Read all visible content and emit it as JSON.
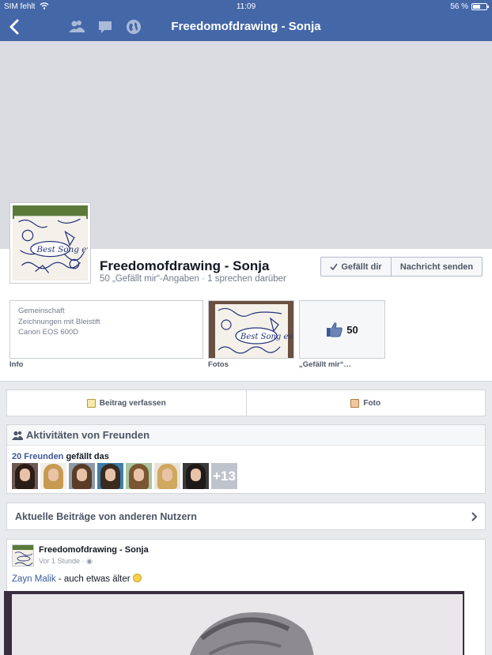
{
  "status_bar": {
    "carrier": "SIM fehlt",
    "time": "11:09",
    "battery": "56 %"
  },
  "nav": {
    "title": "Freedomofdrawing - Sonja",
    "icons": [
      "back-chevron-icon",
      "friends-icon",
      "messages-icon",
      "globe-icon"
    ]
  },
  "page": {
    "name": "Freedomofdrawing - Sonja",
    "subtitle": "50 „Gefällt mir“-Angaben · 1 sprechen darüber",
    "like_button": "Gefällt dir",
    "message_button": "Nachricht senden"
  },
  "info": {
    "lines": [
      "Gemeinschaft",
      "Zeichnungen mit Bleistift",
      "Canon EOS 600D"
    ],
    "label": "Info"
  },
  "photos": {
    "label": "Fotos",
    "drawing_text": "Best Song ever"
  },
  "likes": {
    "count": "50",
    "label": "„Gefällt mir“…"
  },
  "composer": {
    "post_label": "Beitrag verfassen",
    "photo_label": "Foto"
  },
  "friends": {
    "heading": "Aktivitäten von Freunden",
    "count_link": "20 Freunden",
    "suffix": " gefällt das",
    "more": "+13",
    "hair_colors": [
      "#2b1d17",
      "#c79a52",
      "#5a3d26",
      "#3a2a20",
      "#7a5632",
      "#d0a85e",
      "#1f1a18"
    ],
    "bg_colors": [
      "#6e5a52",
      "#f2efe9",
      "#8f9aa8",
      "#3f7ea8",
      "#a8c6a0",
      "#e9e3d8",
      "#3a3a3a"
    ]
  },
  "recent": {
    "label": "Aktuelle Beiträge von anderen Nutzern"
  },
  "post": {
    "author": "Freedomofdrawing - Sonja",
    "time": "Vor 1 Stunde ·",
    "mention": "Zayn Malik",
    "text": " - auch etwas älter "
  },
  "colors": {
    "brand_blue": "#4467a8",
    "link_blue": "#3b5998",
    "cover_gray": "#dadce1"
  }
}
